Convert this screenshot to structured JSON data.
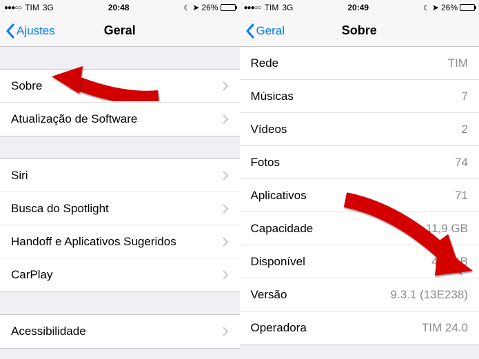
{
  "left": {
    "status": {
      "carrier": "TIM",
      "network": "3G",
      "time": "20:48",
      "battery": "26%"
    },
    "nav": {
      "back": "Ajustes",
      "title": "Geral"
    },
    "groups": [
      {
        "rows": [
          {
            "label": "Sobre"
          },
          {
            "label": "Atualização de Software"
          }
        ]
      },
      {
        "rows": [
          {
            "label": "Siri"
          },
          {
            "label": "Busca do Spotlight"
          },
          {
            "label": "Handoff e Aplicativos Sugeridos"
          },
          {
            "label": "CarPlay"
          }
        ]
      },
      {
        "rows": [
          {
            "label": "Acessibilidade"
          }
        ]
      }
    ]
  },
  "right": {
    "status": {
      "carrier": "TIM",
      "network": "3G",
      "time": "20:49",
      "battery": "26%"
    },
    "nav": {
      "back": "Geral",
      "title": "Sobre"
    },
    "rows": [
      {
        "label": "Rede",
        "value": "TIM"
      },
      {
        "label": "Músicas",
        "value": "7"
      },
      {
        "label": "Vídeos",
        "value": "2"
      },
      {
        "label": "Fotos",
        "value": "74"
      },
      {
        "label": "Aplicativos",
        "value": "71"
      },
      {
        "label": "Capacidade",
        "value": "11,9 GB"
      },
      {
        "label": "Disponível",
        "value": "4,0 GB"
      },
      {
        "label": "Versão",
        "value": "9.3.1 (13E238)"
      },
      {
        "label": "Operadora",
        "value": "TIM 24.0"
      }
    ]
  }
}
